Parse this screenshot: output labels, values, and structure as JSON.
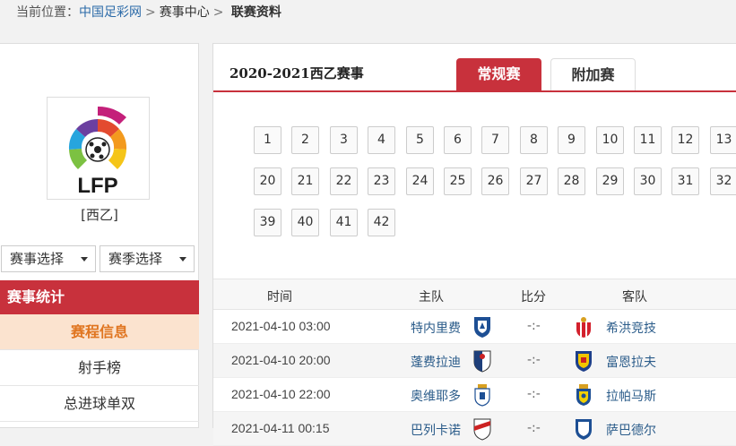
{
  "breadcrumb": {
    "prefix": "当前位置：",
    "site": "中国足彩网",
    "section": "赛事中心",
    "current": "联赛资料"
  },
  "sidebar": {
    "league_name": "[西乙]",
    "select_event": "赛事选择",
    "select_season": "赛季选择",
    "stats_header": "赛事统计",
    "items": [
      {
        "label": "赛程信息",
        "active": true
      },
      {
        "label": "射手榜",
        "active": false
      },
      {
        "label": "总进球单双",
        "active": false
      }
    ]
  },
  "main": {
    "season_title": "2020-2021西乙赛事",
    "tabs": [
      {
        "label": "常规赛",
        "active": true
      },
      {
        "label": "附加赛",
        "active": false
      }
    ],
    "rounds": [
      "1",
      "2",
      "3",
      "4",
      "5",
      "6",
      "7",
      "8",
      "9",
      "10",
      "11",
      "12",
      "13",
      "20",
      "21",
      "22",
      "23",
      "24",
      "25",
      "26",
      "27",
      "28",
      "29",
      "30",
      "31",
      "32",
      "39",
      "40",
      "41",
      "42"
    ],
    "table": {
      "headers": {
        "time": "时间",
        "home": "主队",
        "score": "比分",
        "away": "客队"
      },
      "rows": [
        {
          "time": "2021-04-10 03:00",
          "home": "特内里费",
          "score": "-:-",
          "away": "希洪竞技"
        },
        {
          "time": "2021-04-10 20:00",
          "home": "蓬费拉迪",
          "score": "-:-",
          "away": "富恩拉夫"
        },
        {
          "time": "2021-04-10 22:00",
          "home": "奥维耶多",
          "score": "-:-",
          "away": "拉帕马斯"
        },
        {
          "time": "2021-04-11 00:15",
          "home": "巴列卡诺",
          "score": "-:-",
          "away": "萨巴德尔"
        }
      ]
    }
  },
  "colors": {
    "accent": "#c8313c",
    "active_bg": "#fbe3cf",
    "active_text": "#e07520",
    "link": "#2b6aa8"
  }
}
